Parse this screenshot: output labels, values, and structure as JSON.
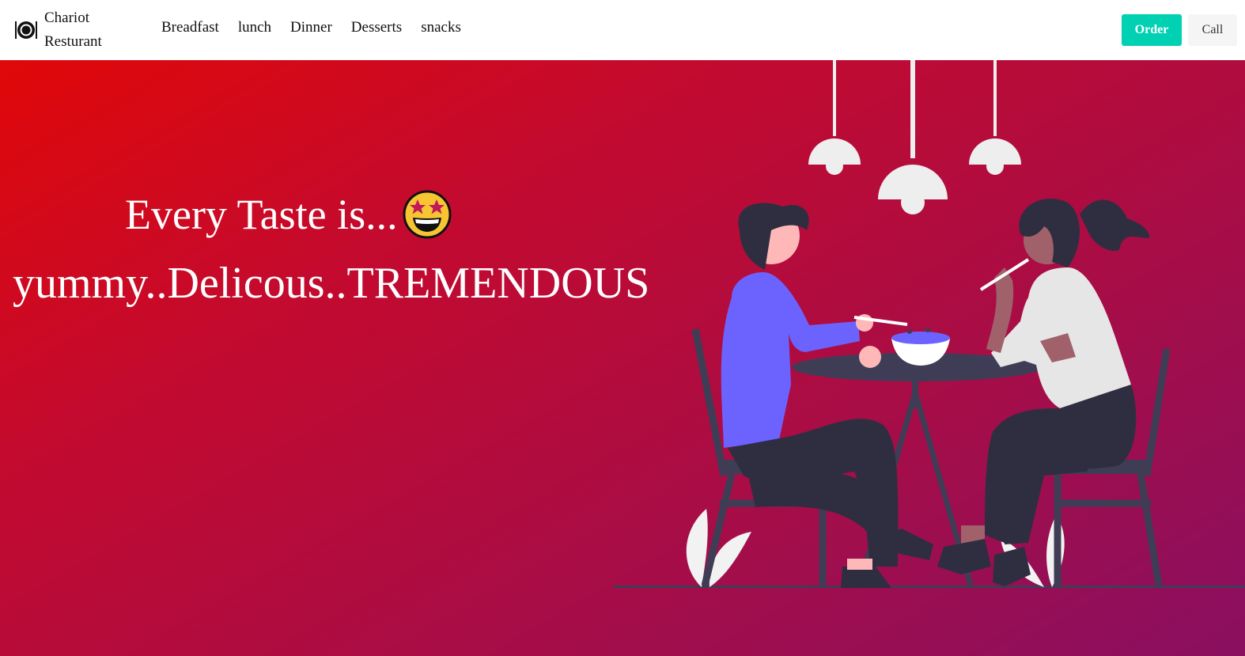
{
  "brand": {
    "name_line1": "Chariot",
    "name_line2": "Resturant",
    "logo_icon": "plate-cutlery-icon"
  },
  "nav": {
    "items": [
      {
        "label": "Breadfast"
      },
      {
        "label": "lunch"
      },
      {
        "label": "Dinner"
      },
      {
        "label": "Desserts"
      },
      {
        "label": "snacks"
      }
    ]
  },
  "actions": {
    "order_label": "Order",
    "call_label": "Call"
  },
  "hero": {
    "line1": "Every Taste is...",
    "emoji_icon": "star-struck-emoji-icon",
    "line2": "yummy..Delicous..TREMENDOUS",
    "illustration": "couple-dining-illustration"
  },
  "colors": {
    "accent": "#00d1b2",
    "gradient_start": "#e00808",
    "gradient_end": "#8a0f60",
    "navbar_bg": "#ffffff"
  }
}
